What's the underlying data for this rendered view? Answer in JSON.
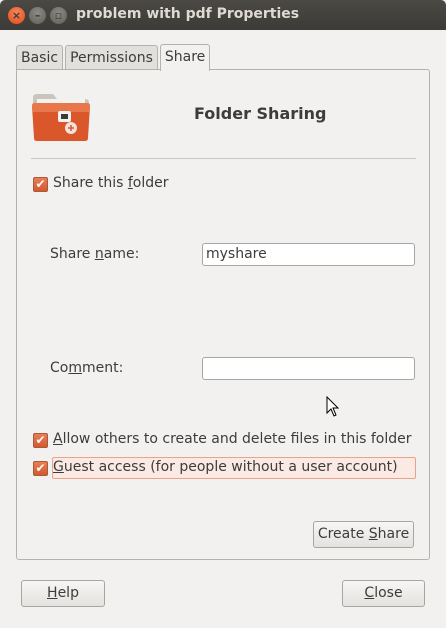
{
  "window": {
    "title": "problem with pdf Properties",
    "close_glyph": "×",
    "min_glyph": "–",
    "max_glyph": "▫"
  },
  "tabs": [
    {
      "label": "Basic",
      "active": false
    },
    {
      "label": "Permissions",
      "active": false
    },
    {
      "label": "Share",
      "active": true
    }
  ],
  "share": {
    "heading": "Folder Sharing",
    "share_folder": {
      "pre": "Share this ",
      "mnemonic": "f",
      "post": "older",
      "checked": true
    },
    "share_name": {
      "pre": "Share ",
      "mnemonic": "n",
      "post": "ame:",
      "value": "myshare"
    },
    "comment": {
      "pre": "Co",
      "mnemonic": "m",
      "post": "ment:",
      "value": ""
    },
    "allow_others": {
      "mnemonic": "A",
      "post": "llow others to create and delete files in this folder",
      "checked": true
    },
    "guest_access": {
      "mnemonic": "G",
      "post": "uest access (for people without a user account)",
      "checked": true
    },
    "create_share": {
      "pre": "Create ",
      "mnemonic": "S",
      "post": "hare"
    }
  },
  "footer": {
    "help": {
      "mnemonic": "H",
      "post": "elp"
    },
    "close": {
      "mnemonic": "C",
      "post": "lose"
    }
  },
  "check_glyph": "✔",
  "colors": {
    "accent": "#dd5a2a",
    "titlebar": "#3c3b37",
    "background": "#f2f1f0"
  }
}
